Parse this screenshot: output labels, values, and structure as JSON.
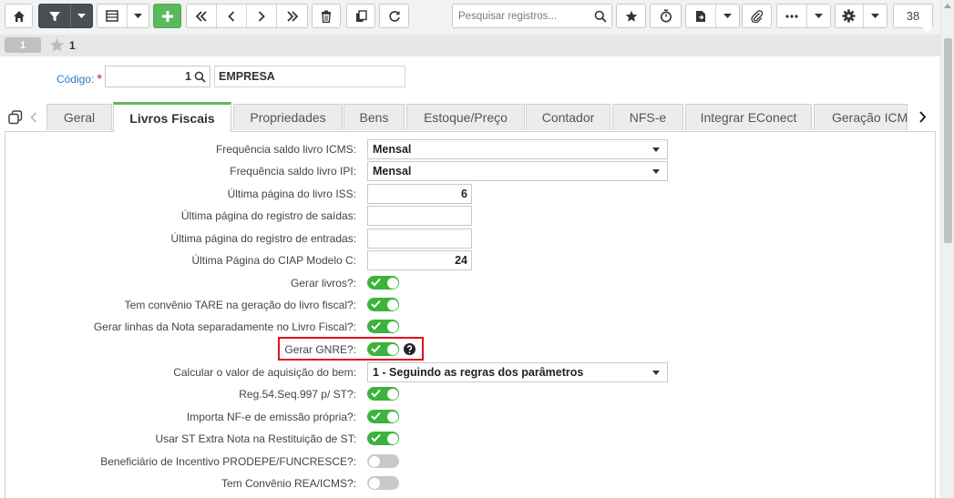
{
  "toolbar": {
    "search_placeholder": "Pesquisar registros...",
    "record_count": "38",
    "icons": [
      "home-icon",
      "filter-icon",
      "grid-view-icon",
      "add-icon",
      "first-icon",
      "previous-icon",
      "next-icon",
      "last-icon",
      "delete-icon",
      "copy-icon",
      "refresh-icon",
      "search-icon",
      "star-icon",
      "timer-icon",
      "report-icon",
      "attach-icon",
      "more-icon",
      "gear-icon"
    ]
  },
  "record_bar": {
    "index": "1",
    "record_number": "1"
  },
  "header": {
    "codigo_label": "Código:",
    "required_mark": "*",
    "codigo_value": "1",
    "empresa_value": "EMPRESA"
  },
  "tabs": [
    {
      "label": "Geral"
    },
    {
      "label": "Livros Fiscais",
      "active": true
    },
    {
      "label": "Propriedades"
    },
    {
      "label": "Bens"
    },
    {
      "label": "Estoque/Preço"
    },
    {
      "label": "Contador"
    },
    {
      "label": "NFS-e"
    },
    {
      "label": "Integrar EConect"
    },
    {
      "label": "Geração ICMS"
    }
  ],
  "fields": [
    {
      "label": "Frequência saldo livro ICMS:",
      "type": "select",
      "value": "Mensal"
    },
    {
      "label": "Frequência saldo livro IPI:",
      "type": "select",
      "value": "Mensal"
    },
    {
      "label": "Última página do livro ISS:",
      "type": "number",
      "value": "6"
    },
    {
      "label": "Última página do registro de saídas:",
      "type": "number",
      "value": ""
    },
    {
      "label": "Última página do registro de entradas:",
      "type": "number",
      "value": ""
    },
    {
      "label": "Última Página do CIAP Modelo C:",
      "type": "number",
      "value": "24"
    },
    {
      "label": "Gerar livros?:",
      "type": "toggle",
      "value": "on"
    },
    {
      "label": "Tem convênio TARE na geração do livro fiscal?:",
      "type": "toggle",
      "value": "on"
    },
    {
      "label": "Gerar linhas da Nota separadamente no Livro Fiscal?:",
      "type": "toggle",
      "value": "on"
    },
    {
      "label": "Gerar GNRE?:",
      "type": "toggle",
      "value": "on",
      "help": true,
      "highlighted": true
    },
    {
      "label": "Calcular o valor de aquisição do bem:",
      "type": "select",
      "value": "1 - Seguindo as regras dos parâmetros"
    },
    {
      "label": "Reg.54.Seq.997 p/ ST?:",
      "type": "toggle",
      "value": "on"
    },
    {
      "label": "Importa NF-e de emissão própria?:",
      "type": "toggle",
      "value": "on"
    },
    {
      "label": "Usar ST Extra Nota na Restituição de ST:",
      "type": "toggle",
      "value": "on"
    },
    {
      "label": "Beneficiário de Incentivo PRODEPE/FUNCRESCE?:",
      "type": "toggle",
      "value": "off"
    },
    {
      "label": "Tem Convênio REA/ICMS?:",
      "type": "toggle",
      "value": "off"
    }
  ],
  "colors": {
    "toggle_on": "#3cb33c",
    "toggle_off": "#c9c9c9",
    "active_tab_accent": "#5cb85c",
    "highlight_box": "#e0101b",
    "label_link": "#2a7ac0"
  }
}
